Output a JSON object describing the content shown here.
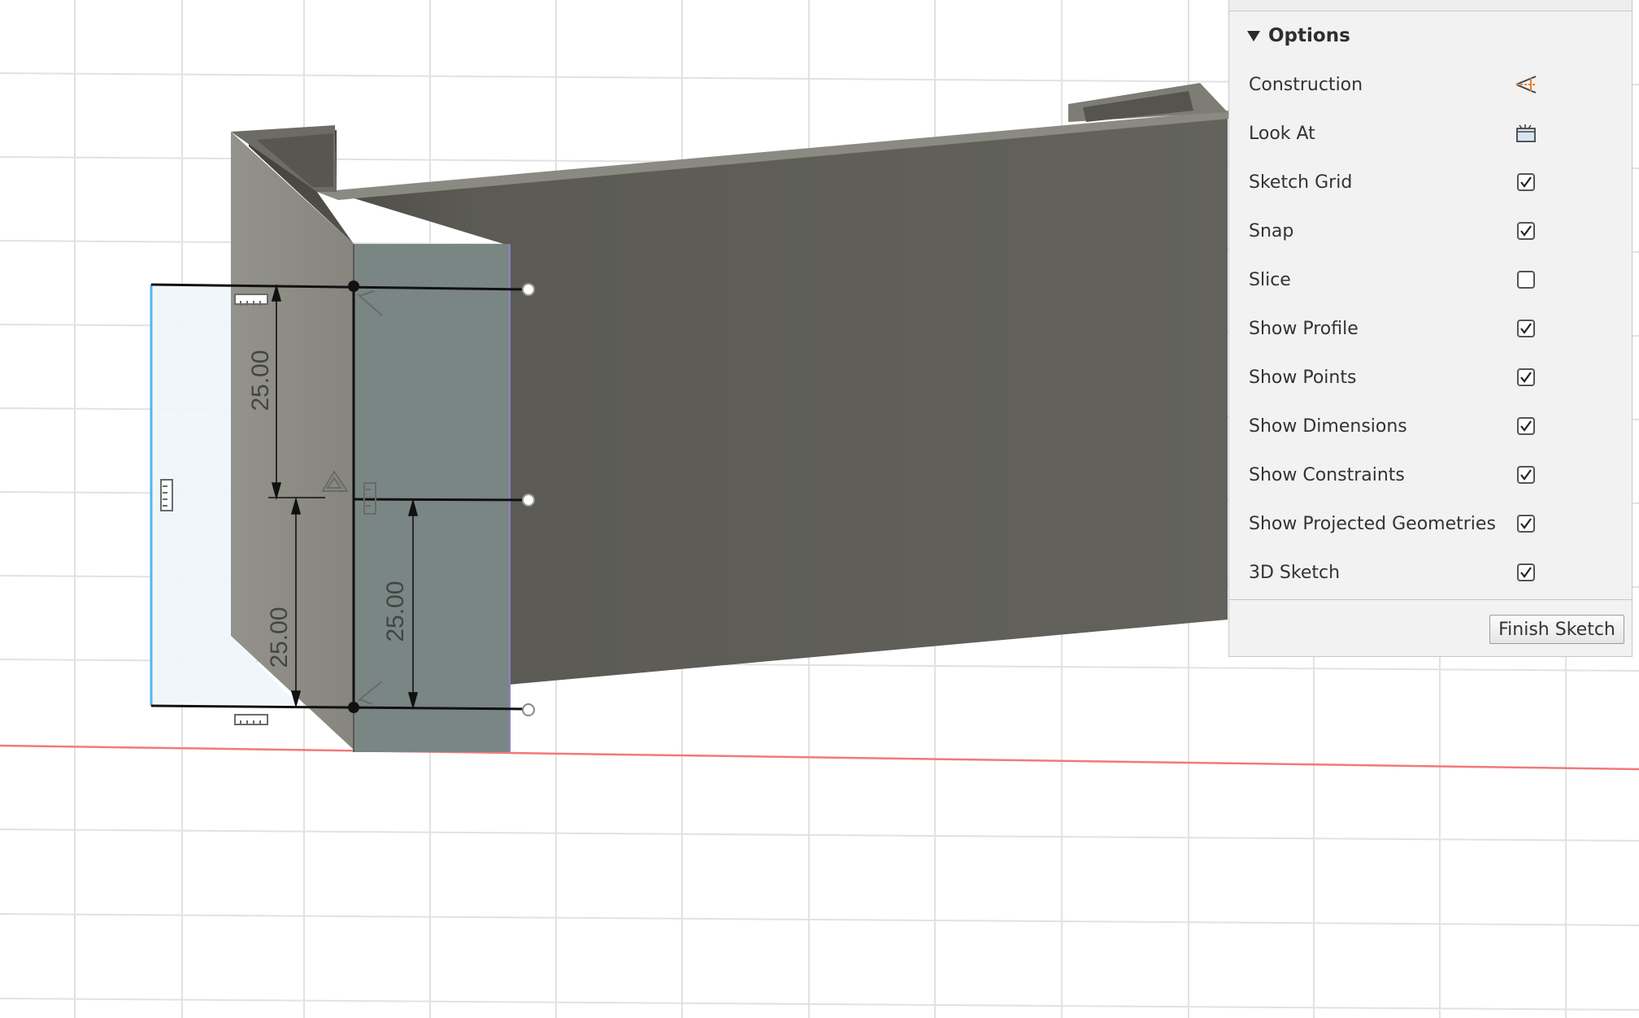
{
  "viewport": {
    "dimensions": [
      {
        "name": "dimension-upper-left",
        "value": "25.00"
      },
      {
        "name": "dimension-lower-left",
        "value": "25.00"
      },
      {
        "name": "dimension-right",
        "value": "25.00"
      }
    ]
  },
  "options_panel": {
    "title": "Options",
    "rows": [
      {
        "label": "Construction",
        "control": "icon",
        "icon": "construction-icon"
      },
      {
        "label": "Look At",
        "control": "icon",
        "icon": "look-at-icon"
      },
      {
        "label": "Sketch Grid",
        "control": "checkbox",
        "checked": true
      },
      {
        "label": "Snap",
        "control": "checkbox",
        "checked": true
      },
      {
        "label": "Slice",
        "control": "checkbox",
        "checked": false
      },
      {
        "label": "Show Profile",
        "control": "checkbox",
        "checked": true
      },
      {
        "label": "Show Points",
        "control": "checkbox",
        "checked": true
      },
      {
        "label": "Show Dimensions",
        "control": "checkbox",
        "checked": true
      },
      {
        "label": "Show Constraints",
        "control": "checkbox",
        "checked": true
      },
      {
        "label": "Show Projected Geometries",
        "control": "checkbox",
        "checked": true
      },
      {
        "label": "3D Sketch",
        "control": "checkbox",
        "checked": true
      }
    ],
    "finish_label": "Finish Sketch"
  },
  "colors": {
    "x_axis": "#f07a7a",
    "model_face_dark": "#5f5e57",
    "model_face_light": "#8c8b84",
    "model_front_face": "#7a8684",
    "sketch_profile_fill": "#eef6fd",
    "sketch_profile_edge": "#5ab4e8",
    "panel_background": "#f2f2f2"
  }
}
